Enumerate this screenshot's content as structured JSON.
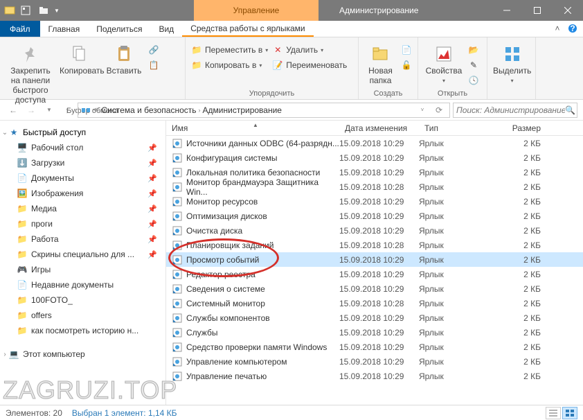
{
  "titlebar": {
    "context_tab": "Управление",
    "title": "Администрирование"
  },
  "ribbon_tabs": {
    "file": "Файл",
    "home": "Главная",
    "share": "Поделиться",
    "view": "Вид",
    "shortcut": "Средства работы с ярлыками"
  },
  "ribbon": {
    "pin": "Закрепить на панели быстрого доступа",
    "copy": "Копировать",
    "paste": "Вставить",
    "clipboard_group": "Буфер обмена",
    "move_to": "Переместить в",
    "copy_to": "Копировать в",
    "delete": "Удалить",
    "rename": "Переименовать",
    "organize_group": "Упорядочить",
    "new_folder": "Новая папка",
    "new_group": "Создать",
    "properties": "Свойства",
    "open_group": "Открыть",
    "select": "Выделить"
  },
  "breadcrumb": {
    "seg1": "Система и безопасность",
    "seg2": "Администрирование"
  },
  "search": {
    "placeholder": "Поиск: Администрирование"
  },
  "nav": {
    "quick": "Быстрый доступ",
    "items": [
      {
        "label": "Рабочий стол",
        "pin": true
      },
      {
        "label": "Загрузки",
        "pin": true
      },
      {
        "label": "Документы",
        "pin": true
      },
      {
        "label": "Изображения",
        "pin": true
      },
      {
        "label": "Медиа",
        "pin": true
      },
      {
        "label": "проги",
        "pin": true
      },
      {
        "label": "Работа",
        "pin": true
      },
      {
        "label": "Скрины специально для ...",
        "pin": true
      },
      {
        "label": "Игры",
        "pin": false
      },
      {
        "label": "Недавние документы",
        "pin": false
      },
      {
        "label": "100FOTO_",
        "pin": false
      },
      {
        "label": "offers",
        "pin": false
      },
      {
        "label": "как посмотреть историю н...",
        "pin": false
      }
    ],
    "this_pc": "Этот компьютер"
  },
  "columns": {
    "name": "Имя",
    "date": "Дата изменения",
    "type": "Тип",
    "size": "Размер"
  },
  "files": [
    {
      "name": "Источники данных ODBC (64-разрядн...",
      "date": "15.09.2018 10:29",
      "type": "Ярлык",
      "size": "2 КБ"
    },
    {
      "name": "Конфигурация системы",
      "date": "15.09.2018 10:29",
      "type": "Ярлык",
      "size": "2 КБ"
    },
    {
      "name": "Локальная политика безопасности",
      "date": "15.09.2018 10:29",
      "type": "Ярлык",
      "size": "2 КБ"
    },
    {
      "name": "Монитор брандмауэра Защитника Win...",
      "date": "15.09.2018 10:28",
      "type": "Ярлык",
      "size": "2 КБ"
    },
    {
      "name": "Монитор ресурсов",
      "date": "15.09.2018 10:29",
      "type": "Ярлык",
      "size": "2 КБ"
    },
    {
      "name": "Оптимизация дисков",
      "date": "15.09.2018 10:29",
      "type": "Ярлык",
      "size": "2 КБ"
    },
    {
      "name": "Очистка диска",
      "date": "15.09.2018 10:29",
      "type": "Ярлык",
      "size": "2 КБ"
    },
    {
      "name": "Планировщик заданий",
      "date": "15.09.2018 10:28",
      "type": "Ярлык",
      "size": "2 КБ"
    },
    {
      "name": "Просмотр событий",
      "date": "15.09.2018 10:29",
      "type": "Ярлык",
      "size": "2 КБ",
      "selected": true
    },
    {
      "name": "Редактор реестра",
      "date": "15.09.2018 10:29",
      "type": "Ярлык",
      "size": "2 КБ"
    },
    {
      "name": "Сведения о системе",
      "date": "15.09.2018 10:29",
      "type": "Ярлык",
      "size": "2 КБ"
    },
    {
      "name": "Системный монитор",
      "date": "15.09.2018 10:28",
      "type": "Ярлык",
      "size": "2 КБ"
    },
    {
      "name": "Службы компонентов",
      "date": "15.09.2018 10:29",
      "type": "Ярлык",
      "size": "2 КБ"
    },
    {
      "name": "Службы",
      "date": "15.09.2018 10:29",
      "type": "Ярлык",
      "size": "2 КБ"
    },
    {
      "name": "Средство проверки памяти Windows",
      "date": "15.09.2018 10:29",
      "type": "Ярлык",
      "size": "2 КБ"
    },
    {
      "name": "Управление компьютером",
      "date": "15.09.2018 10:29",
      "type": "Ярлык",
      "size": "2 КБ"
    },
    {
      "name": "Управление печатью",
      "date": "15.09.2018 10:29",
      "type": "Ярлык",
      "size": "2 КБ"
    }
  ],
  "status": {
    "count": "Элементов: 20",
    "selection": "Выбран 1 элемент: 1,14 КБ"
  },
  "watermark": "ZAGRUZI.TOP"
}
